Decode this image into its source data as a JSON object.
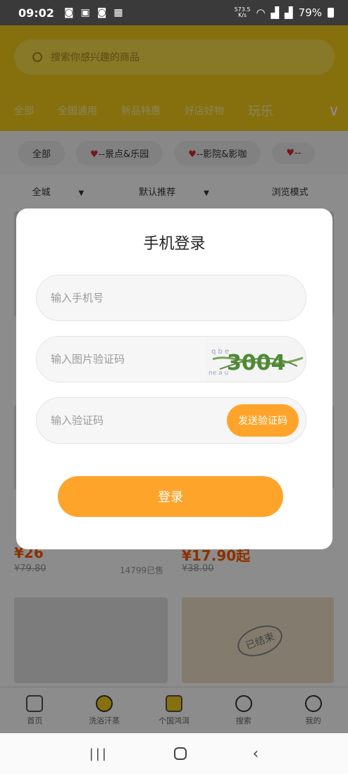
{
  "status_bar": {
    "time": "09:02",
    "speed": "573.5",
    "speed_unit": "K/s",
    "battery": "79%"
  },
  "header": {
    "search_placeholder": "搜索你感兴趣的商品",
    "tabs": [
      "全部",
      "全国通用",
      "新品特惠",
      "好店好物",
      "玩乐"
    ]
  },
  "filter_chips": [
    {
      "label": "全部"
    },
    {
      "label": "--景点&乐园"
    },
    {
      "label": "--影院&影咖"
    },
    {
      "label": "--"
    }
  ],
  "sort_bar": {
    "area": "全城",
    "sort": "默认推荐",
    "mode": "浏览模式"
  },
  "products": [
    {
      "price": "¥26",
      "old_price": "¥79.80",
      "sold": "14799已售"
    },
    {
      "price": "¥17.90起",
      "old_price": "¥38.00",
      "sold": ""
    }
  ],
  "stamp_text": "已结束",
  "tabbar": {
    "items": [
      {
        "label": "首页",
        "icon": "home-icon"
      },
      {
        "label": "洗浴汗蒸",
        "icon": "planet-icon"
      },
      {
        "label": "个国鸿洱",
        "icon": "truck-icon"
      },
      {
        "label": "搜索",
        "icon": "search-icon"
      },
      {
        "label": "我的",
        "icon": "user-icon"
      }
    ]
  },
  "login_modal": {
    "title": "手机登录",
    "phone_placeholder": "输入手机号",
    "image_code_placeholder": "输入图片验证码",
    "captcha_text": "3004",
    "sms_code_placeholder": "输入验证码",
    "send_code_label": "发送验证码",
    "login_label": "登录"
  },
  "colors": {
    "accent": "#ffa42b",
    "header_yellow": "#f5cd1a",
    "price_red": "#ff5a00"
  }
}
